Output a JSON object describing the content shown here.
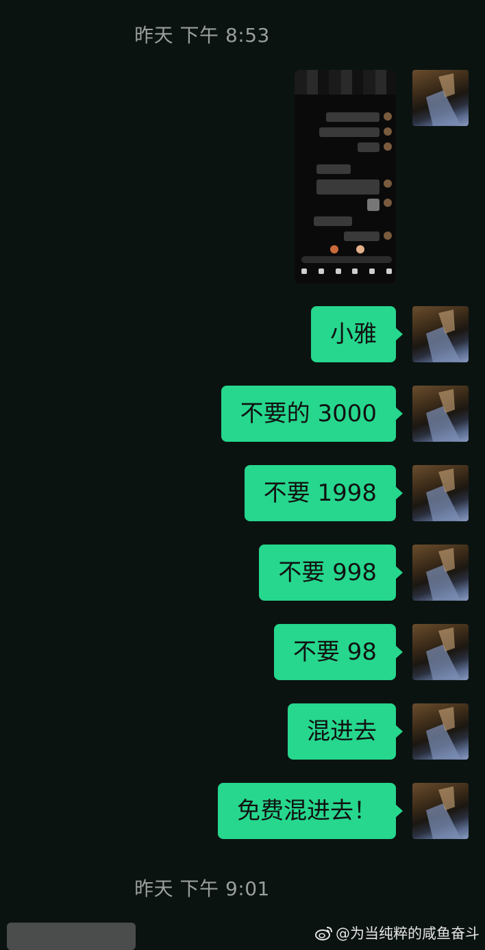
{
  "timestamps": {
    "top": "昨天 下午 8:53",
    "bottom": "昨天 下午 9:01"
  },
  "messages": [
    {
      "type": "image",
      "sender": "me"
    },
    {
      "type": "text",
      "sender": "me",
      "text": "小雅"
    },
    {
      "type": "text",
      "sender": "me",
      "text": "不要的 3000"
    },
    {
      "type": "text",
      "sender": "me",
      "text": "不要 1998"
    },
    {
      "type": "text",
      "sender": "me",
      "text": "不要 998"
    },
    {
      "type": "text",
      "sender": "me",
      "text": "不要 98"
    },
    {
      "type": "text",
      "sender": "me",
      "text": "混进去"
    },
    {
      "type": "text",
      "sender": "me",
      "text": "免费混进去！"
    }
  ],
  "watermark": {
    "icon": "weibo-icon",
    "text": "@为当纯粹的咸鱼奋斗"
  },
  "colors": {
    "background": "#0b1311",
    "bubble": "#26d78d",
    "timestamp": "#9a9f9d"
  }
}
